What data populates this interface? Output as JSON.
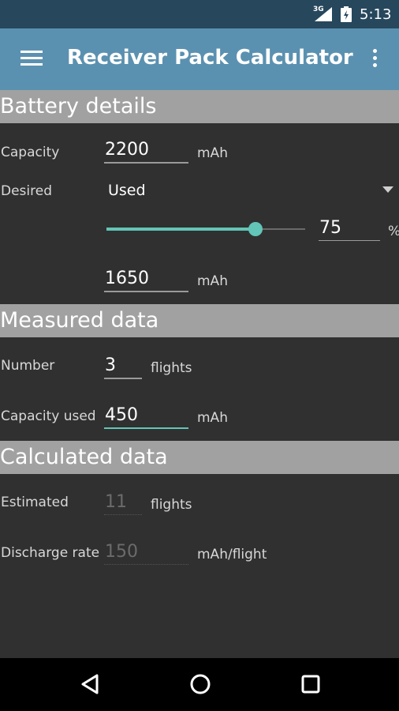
{
  "status": {
    "network": "3G",
    "time": "5:13"
  },
  "app_bar": {
    "title": "Receiver Pack Calculator"
  },
  "battery": {
    "heading": "Battery details",
    "capacity_label": "Capacity",
    "capacity_value": "2200",
    "capacity_unit": "mAh",
    "desired_label": "Desired",
    "desired_selected": "Used",
    "slider_value": 75,
    "percent_value": "75",
    "percent_unit": "%",
    "usable_value": "1650",
    "usable_unit": "mAh"
  },
  "measured": {
    "heading": "Measured data",
    "number_label": "Number",
    "number_value": "3",
    "number_unit": "flights",
    "used_label": "Capacity used",
    "used_value": "450",
    "used_unit": "mAh"
  },
  "calculated": {
    "heading": "Calculated data",
    "estimated_label": "Estimated",
    "estimated_value": "11",
    "estimated_unit": "flights",
    "discharge_label": "Discharge rate",
    "discharge_value": "150",
    "discharge_unit": "mAh/flight"
  },
  "colors": {
    "status_bar": "#27475d",
    "app_bar": "#5b91b0",
    "accent": "#62c5b7",
    "section": "#a1a1a1",
    "background": "#303030"
  }
}
